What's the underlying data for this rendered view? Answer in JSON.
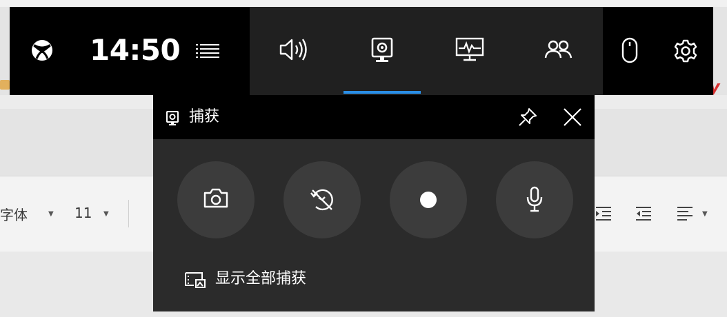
{
  "gamebar": {
    "clock": "14:50",
    "top_icons": [
      "xbox-logo-icon",
      "widget-menu-icon",
      "audio-icon",
      "capture-icon",
      "performance-icon",
      "social-icon",
      "mouse-icon",
      "settings-icon"
    ],
    "active_tab": "capture",
    "accent_color": "#2a8ee6"
  },
  "capture_widget": {
    "title": "捕获",
    "buttons": [
      "screenshot",
      "record-last-30s",
      "start-recording",
      "microphone"
    ],
    "show_all_label": "显示全部捕获"
  },
  "background_app": {
    "font_name": "字体",
    "font_size": "11"
  }
}
